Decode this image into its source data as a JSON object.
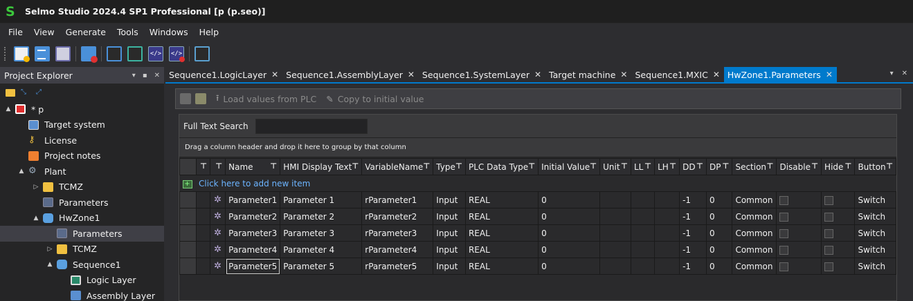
{
  "app": {
    "title": "Selmo Studio 2024.4 SP1 Professional  [p (p.seo)]",
    "logo_letter": "S"
  },
  "menu": [
    "File",
    "View",
    "Generate",
    "Tools",
    "Windows",
    "Help"
  ],
  "toolbar": {
    "icons": [
      "new-project-icon",
      "list-icon",
      "save-icon",
      "close-project-icon",
      "window-icon",
      "window-green-icon",
      "code-icon",
      "code-red-icon",
      "home-icon"
    ]
  },
  "explorer": {
    "title": "Project Explorer",
    "tree": [
      {
        "label": "* p",
        "level": 0,
        "icon": "project",
        "toggle": "▲"
      },
      {
        "label": "Target system",
        "level": 1,
        "icon": "target",
        "toggle": ""
      },
      {
        "label": "License",
        "level": 1,
        "icon": "license",
        "toggle": ""
      },
      {
        "label": "Project notes",
        "level": 1,
        "icon": "notes",
        "toggle": ""
      },
      {
        "label": "Plant",
        "level": 1,
        "icon": "plant",
        "toggle": "▲"
      },
      {
        "label": "TCMZ",
        "level": 2,
        "icon": "folder",
        "toggle": "▷"
      },
      {
        "label": "Parameters",
        "level": 2,
        "icon": "params",
        "toggle": ""
      },
      {
        "label": "HwZone1",
        "level": 2,
        "icon": "cube",
        "toggle": "▲"
      },
      {
        "label": "Parameters",
        "level": 3,
        "icon": "params",
        "toggle": "",
        "selected": true
      },
      {
        "label": "TCMZ",
        "level": 3,
        "icon": "folder",
        "toggle": "▷"
      },
      {
        "label": "Sequence1",
        "level": 3,
        "icon": "cube",
        "toggle": "▲"
      },
      {
        "label": "Logic Layer",
        "level": 4,
        "icon": "logic",
        "toggle": ""
      },
      {
        "label": "Assembly Layer",
        "level": 4,
        "icon": "assembly",
        "toggle": ""
      }
    ]
  },
  "tabs": [
    {
      "label": "Sequence1.LogicLayer",
      "active": false
    },
    {
      "label": "Sequence1.AssemblyLayer",
      "active": false
    },
    {
      "label": "Sequence1.SystemLayer",
      "active": false
    },
    {
      "label": "Target machine",
      "active": false
    },
    {
      "label": "Sequence1.MXIC",
      "active": false
    },
    {
      "label": "HwZone1.Parameters",
      "active": true
    }
  ],
  "doc_toolbar": {
    "load_label": "Load values from PLC",
    "copy_label": "Copy to initial value"
  },
  "search": {
    "label": "Full Text Search",
    "value": ""
  },
  "group_hint": "Drag a column header and drop it here to group by that column",
  "new_item_label": "Click here to add new item",
  "grid": {
    "columns": [
      "",
      "",
      "Name",
      "HMI Display Text",
      "VariableName",
      "Type",
      "PLC Data Type",
      "Initial Value",
      "Unit",
      "LL",
      "LH",
      "DD",
      "DP",
      "Section",
      "Disable",
      "Hide",
      "Button"
    ],
    "rows": [
      {
        "name": "Parameter1",
        "hmi": "Parameter 1",
        "var": "rParameter1",
        "type": "Input",
        "plc": "REAL",
        "init": "0",
        "unit": "",
        "ll": "",
        "lh": "",
        "dd": "-1",
        "dp": "0",
        "section": "Common",
        "disable": false,
        "hide": false,
        "button": "Switch"
      },
      {
        "name": "Parameter2",
        "hmi": "Parameter 2",
        "var": "rParameter2",
        "type": "Input",
        "plc": "REAL",
        "init": "0",
        "unit": "",
        "ll": "",
        "lh": "",
        "dd": "-1",
        "dp": "0",
        "section": "Common",
        "disable": false,
        "hide": false,
        "button": "Switch"
      },
      {
        "name": "Parameter3",
        "hmi": "Parameter 3",
        "var": "rParameter3",
        "type": "Input",
        "plc": "REAL",
        "init": "0",
        "unit": "",
        "ll": "",
        "lh": "",
        "dd": "-1",
        "dp": "0",
        "section": "Common",
        "disable": false,
        "hide": false,
        "button": "Switch"
      },
      {
        "name": "Parameter4",
        "hmi": "Parameter 4",
        "var": "rParameter4",
        "type": "Input",
        "plc": "REAL",
        "init": "0",
        "unit": "",
        "ll": "",
        "lh": "",
        "dd": "-1",
        "dp": "0",
        "section": "Common",
        "disable": false,
        "hide": false,
        "button": "Switch"
      },
      {
        "name": "Parameter5",
        "hmi": "Parameter 5",
        "var": "rParameter5",
        "type": "Input",
        "plc": "REAL",
        "init": "0",
        "unit": "",
        "ll": "",
        "lh": "",
        "dd": "-1",
        "dp": "0",
        "section": "Common",
        "disable": false,
        "hide": false,
        "button": "Switch"
      }
    ]
  },
  "colors": {
    "accent": "#007acc",
    "background": "#2d2d30",
    "logo": "#3cc83c",
    "link": "#6cb4ff"
  }
}
